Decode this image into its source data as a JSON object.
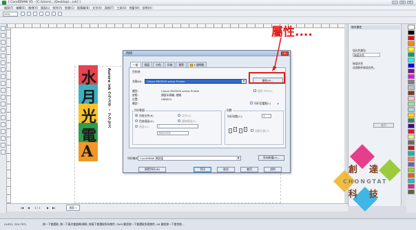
{
  "window": {
    "title": "[ CorelDRAW X5 - [C:\\Users\\...\\Desktop\\...cdr] ]"
  },
  "menu": [
    "檔案(F)",
    "編輯(E)",
    "檢視(V)",
    "版面(L)",
    "排列(A)",
    "效果(C)",
    "點陣圖(B)",
    "文字(X)",
    "表格(T)",
    "工具(O)",
    "視窗(W)",
    "說明(H)"
  ],
  "toolbar": {
    "zoom_value": "25%"
  },
  "annotation": {
    "text": "屬性....",
    "color": "#e21b1b"
  },
  "artwork": {
    "blocks": [
      {
        "char": "水",
        "color": "#e9414d"
      },
      {
        "char": "月",
        "color": "#3bb0c4"
      },
      {
        "char": "光",
        "color": "#f6c22a"
      },
      {
        "char": "電",
        "color": "#2e9e4d"
      },
      {
        "char": "A",
        "color": "#f29727"
      }
    ],
    "side_text": "Aurora ink クラスタ ・ アクセス"
  },
  "print_dialog": {
    "title": "列印",
    "tabs": [
      "一般",
      "版面",
      "分色",
      "印前",
      "預覽",
      "1 個問題"
    ],
    "destination_heading": "目的地",
    "name_label": "名稱(N):",
    "printer_name": "Canon MG3500 series Printer",
    "properties_button": "屬性(P)...",
    "type_label": "類型:",
    "type_value": "Canon MG3500 series Printer",
    "status_label": "狀態:",
    "status_value": "預設印表機; 就緒",
    "where_label": "位置:",
    "where_value": "USB004",
    "comment_label": "備註:",
    "print_to_file_label": "列印至檔案(L)",
    "use_ppd_label": "使用 PPD(E)",
    "print_range_heading": "列印範圍",
    "range_options": [
      "目前文件(R)",
      "目前頁面(U)",
      "頁面(G):"
    ],
    "range_options_right": [
      "文件(O)",
      "選取範圍(S)"
    ],
    "pages_value": "1",
    "even_odd_value": "偶數與奇數",
    "copies_heading": "份數",
    "copies_label": "列印份數(C):",
    "copies_value": "1",
    "collate_label": "自動分頁(O)",
    "print_style_label": "列印樣式(Y):",
    "print_style_value": "CorelDRAW 預設值",
    "save_as_button": "另存新檔(V)...",
    "buttons": {
      "print_preview": "預覽列印(W)",
      "print": "列印",
      "cancel": "取消",
      "apply": "套用",
      "help": "說明"
    }
  },
  "docker": {
    "title": "物件屬性",
    "fill_type_label": "填充色類型:",
    "fill_type_value": "無填充色",
    "note_line1": "無填充色",
    "note_line2": "這個物件無填充色。",
    "apply_button": "套用"
  },
  "palette": [
    "#ffffff",
    "#000000",
    "#ff0000",
    "#ff8800",
    "#ffff00",
    "#00a651",
    "#00ffff",
    "#0000ff",
    "#8b008b",
    "#ff00ff",
    "#808080",
    "#c0c0c0",
    "#7a3d1e",
    "#ffc0cb",
    "#90ee90",
    "#add8e6",
    "#ffd700",
    "#2e8b57",
    "#4b0082",
    "#dc143c",
    "#f0e68c",
    "#696969",
    "#b22222",
    "#20b2aa",
    "#ff7f50",
    "#6a5acd",
    "#9acd32",
    "#d2691e",
    "#00ced1",
    "#ff1493",
    "#556b2f"
  ],
  "pagebar": {
    "page_count": "1 / 1",
    "page_tab": "頁面 1"
  },
  "statusbar": {
    "coords": "(4.631, 220.797)",
    "hint": "按一下會選取; 按一下兩次會旋轉/傾斜; 按兩下會選取所有物件; Shift 鍵並按一下會選取多個物件; Alt 鍵並按一下會挖取..."
  },
  "logo": {
    "chars": [
      "創",
      "達",
      "科",
      "技"
    ],
    "latin": "CHONGTAT",
    "colors": [
      "#e63d8c",
      "#9ccc3c",
      "#f0b62a",
      "#3fb6e6"
    ]
  }
}
